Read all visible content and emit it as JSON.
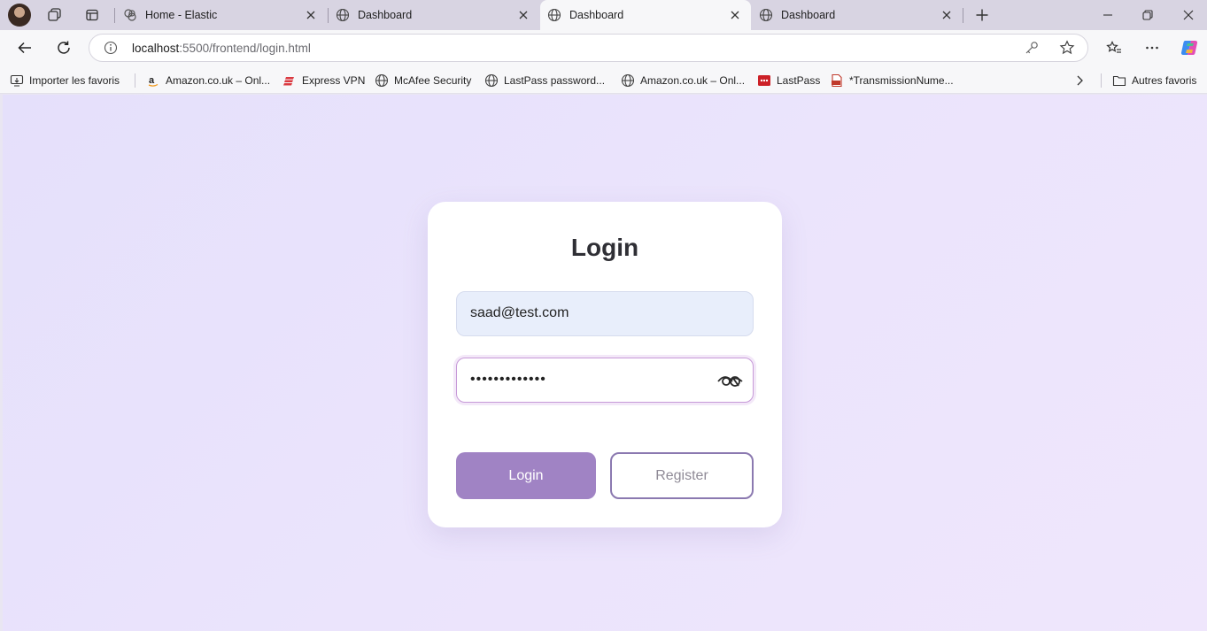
{
  "browser": {
    "tabs": [
      {
        "title": "Home - Elastic",
        "active": false
      },
      {
        "title": "Dashboard",
        "active": false
      },
      {
        "title": "Dashboard",
        "active": true
      },
      {
        "title": "Dashboard",
        "active": false
      }
    ],
    "address": {
      "host": "localhost",
      "path": ":5500/frontend/login.html"
    },
    "bookmarks": {
      "import": "Importer les favoris",
      "items": [
        {
          "label": "Amazon.co.uk – Onl...",
          "icon": "amazon-icon"
        },
        {
          "label": "Express VPN",
          "icon": "expressvpn-icon"
        },
        {
          "label": "McAfee Security",
          "icon": "globe-icon"
        },
        {
          "label": "LastPass password...",
          "icon": "globe-icon"
        },
        {
          "label": "Amazon.co.uk – Onl...",
          "icon": "globe-icon"
        },
        {
          "label": "LastPass",
          "icon": "lastpass-icon"
        },
        {
          "label": "*TransmissionNume...",
          "icon": "pdf-icon"
        }
      ],
      "other": "Autres favoris"
    }
  },
  "page": {
    "title": "Login",
    "email": {
      "value": "saad@test.com"
    },
    "password": {
      "value": "•••••••••••••"
    },
    "buttons": {
      "login": "Login",
      "register": "Register"
    }
  },
  "colors": {
    "accent": "#a083c4",
    "register_border": "#8b79b0",
    "background": "#e9e4fb"
  }
}
